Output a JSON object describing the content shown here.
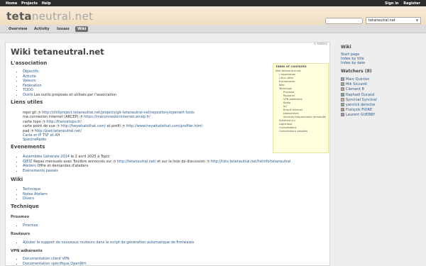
{
  "top_menu": {
    "home": "Home",
    "projects": "Projects",
    "help": "Help",
    "sign_in": "Sign in",
    "register": "Register"
  },
  "header": {
    "logo_dark": "teta",
    "logo_light": "neutral.net",
    "project_jump": "tetaneutral.net"
  },
  "main_menu": {
    "tabs": [
      {
        "label": "Overview"
      },
      {
        "label": "Activity"
      },
      {
        "label": "Issues"
      },
      {
        "label": "Wiki"
      }
    ]
  },
  "content": {
    "history": "History",
    "title": "Wiki tetaneutral.net",
    "association": {
      "heading": "L'association",
      "items": [
        "Objectifs",
        "Activite",
        "Valeurs",
        "Fédération",
        "TODO"
      ],
      "last_link": "Outils",
      "last_rest": " Les outils proposés et utilisés par l'association"
    },
    "liens": {
      "heading": "Liens utiles",
      "l1_label": "repo git",
      "l1_url": "http://chiliproject.tetaneutral.net/projects/git-tetaneutral-net/repository/openwrt-tools",
      "l2_label": "ma connexion internet (ARCEP)",
      "l2_url": "https://maconnexioninternet.arcep.fr/",
      "l3_label": "carte topo",
      "l3_url": "http://francetopo.fr/",
      "l4_label": "carte point de vue",
      "l4_url1": "http://heywhatsthat.com/",
      "l4_mid": " et profil ",
      "l4_url2": "http://www.heywhatsthat.com/profiler.html",
      "l5_label": "pad",
      "l5_url": "http://pad.tetaneutral.net/",
      "l6": "Carte et IP TSF et AH",
      "l7": "SpectreRadio"
    },
    "evenements": {
      "heading": "Evenements",
      "e1_link": "Assemblée Générale 2024",
      "e1_rest": " le 2 avril 2025 à Topic",
      "e2_link": "OJEIZ",
      "e2_rest": " Repas mensuels avec Toulibre annoncés sur ",
      "e2_url1": "http://tetaneutral.net/",
      "e2_mid": " et sur la liste de discussion ",
      "e2_url2": "http://lists.tetaneutral.net/listinfo/tetaneutral",
      "e3_link": "Ateliers",
      "e3_rest": " Offre et demandes d'ateliers",
      "e4_link": "Evénements passés"
    },
    "wiki": {
      "heading": "Wiki",
      "items": [
        "Technique",
        "Notes Ateliers",
        "Divers"
      ]
    },
    "technique": {
      "heading": "Technique",
      "proxmox_heading": "Proxmox",
      "proxmox_items": [
        "Proxmox"
      ],
      "routeurs_heading": "Routeurs",
      "routeurs_link": "Ajouter le support de nouveaux routeurs dans le script de génération automatique de firmwares",
      "vpn_heading": "VPN adhérents",
      "vpn_items": [
        "Documentation client VPN",
        "Documentation spécifique OpenWrt"
      ]
    }
  },
  "toc": {
    "title": "Table of contents",
    "items": [
      {
        "label": "Wiki tetaneutral.net",
        "level": 1
      },
      {
        "label": "L'association",
        "level": 2
      },
      {
        "label": "Liens utiles",
        "level": 2
      },
      {
        "label": "Evenements",
        "level": 2
      },
      {
        "label": "Wiki",
        "level": 2
      },
      {
        "label": "Technique",
        "level": 2
      },
      {
        "label": "Proxmox",
        "level": 3
      },
      {
        "label": "Routeurs",
        "level": 3
      },
      {
        "label": "VPN adhérents",
        "level": 3
      },
      {
        "label": "Radio",
        "level": 3
      },
      {
        "label": "IoT",
        "level": 3
      },
      {
        "label": "Brique Internet",
        "level": 3
      },
      {
        "label": "Datacenters",
        "level": 3
      },
      {
        "label": "Services fréquemment demandés",
        "level": 3
      },
      {
        "label": "Adhérent.e.s",
        "level": 2
      },
      {
        "label": "Logistique",
        "level": 2
      },
      {
        "label": "Consultations",
        "level": 2
      },
      {
        "label": "Consultations passées",
        "level": 2
      }
    ]
  },
  "sidebar": {
    "heading": "Wiki",
    "links": [
      "Start page",
      "Index by title",
      "Index by date"
    ],
    "watchers_heading": "Watchers (8)",
    "watchers": [
      {
        "name": "Marc Quinton",
        "color": "#8da3c8"
      },
      {
        "name": "Mik Siccardi",
        "color": "#9ab08a"
      },
      {
        "name": "Clement B",
        "color": "#c79a9a"
      },
      {
        "name": "Raphaël Durand",
        "color": "#6aa7b5"
      },
      {
        "name": "Syncinal Syncinal",
        "color": "#d6b868"
      },
      {
        "name": "yannick deroche",
        "color": "#7fb57f"
      },
      {
        "name": "François FIORE",
        "color": "#c98f5f"
      },
      {
        "name": "Laurent GUERBY",
        "color": "#a08cc0"
      }
    ]
  }
}
